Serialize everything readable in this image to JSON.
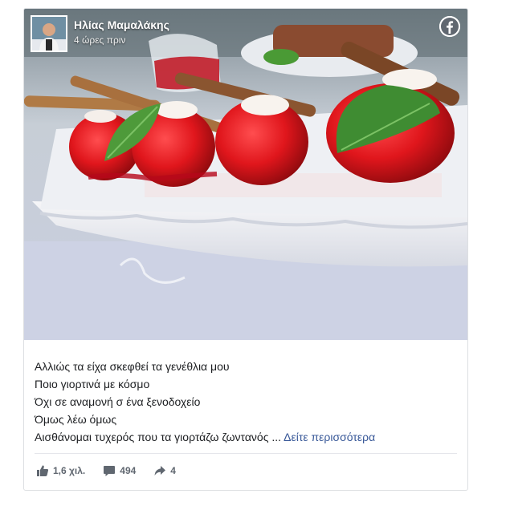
{
  "post": {
    "author_name": "Ηλίας Μαμαλάκης",
    "time_ago": "4 ώρες πριν",
    "caption_lines": [
      "Αλλιώς τα είχα σκεφθεί τα γενέθλια μου",
      "Ποιο γιορτινά με κόσμο",
      "Όχι σε αναμονή σ ένα ξενοδοχείο",
      "Όμως λέω όμως",
      "Αισθάνομαι τυχερός που τα γιορτάζω ζωντανός"
    ],
    "ellipsis": "...",
    "see_more_label": "Δείτε περισσότερα"
  },
  "stats": {
    "likes": "1,6 χιλ.",
    "comments": "494",
    "shares": "4"
  },
  "icons": {
    "brand": "facebook-icon",
    "like": "thumbs-up-icon",
    "comment": "comment-bubble-icon",
    "share": "share-arrow-icon"
  },
  "colors": {
    "link": "#385898",
    "text": "#1c1e21",
    "muted": "#606770",
    "border": "#dddfe2"
  }
}
